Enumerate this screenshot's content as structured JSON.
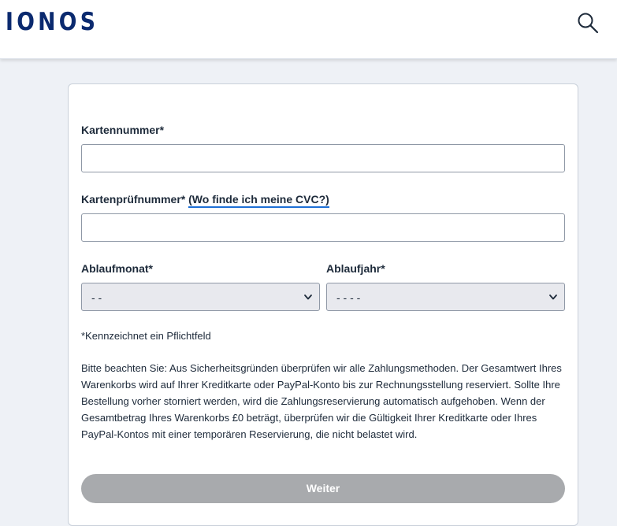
{
  "header": {
    "logo_text": "IONOS",
    "search_icon": "search-icon"
  },
  "form": {
    "card_number_label": "Kartennummer*",
    "card_number_value": "",
    "cvc_label": "Kartenprüfnummer*",
    "cvc_link": "(Wo finde ich meine CVC?)",
    "cvc_value": "",
    "month_label": "Ablaufmonat*",
    "month_selected": "- -",
    "year_label": "Ablaufjahr*",
    "year_selected": "- - - -",
    "required_note": "*Kennzeichnet ein Pflichtfeld",
    "notice": "Bitte beachten Sie: Aus Sicherheitsgründen überprüfen wir alle Zahlungsmethoden. Der Gesamtwert Ihres Warenkorbs wird auf Ihrer Kreditkarte oder PayPal-Konto bis zur Rechnungsstellung reserviert. Sollte Ihre Bestellung vorher storniert werden, wird die Zahlungsreservierung automatisch aufgehoben. Wenn der Gesamtbetrag Ihres Warenkorbs £0 beträgt, überprüfen wir die Gültigkeit Ihrer Kreditkarte oder Ihres PayPal-Kontos mit einer temporären Reservierung, die nicht belastet wird.",
    "submit_label": "Weiter"
  },
  "colors": {
    "brand": "#0b2a6f",
    "link_underline": "#1d6fd6",
    "disabled_button": "#a8aaad",
    "page_bg": "#eef1f6"
  }
}
